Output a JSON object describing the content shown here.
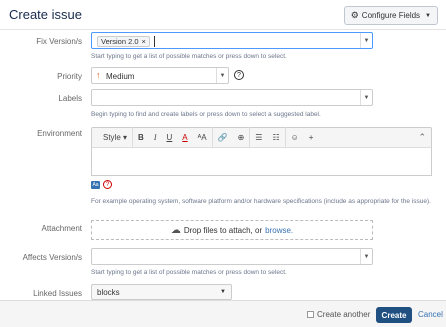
{
  "header": {
    "title": "Create issue",
    "configure_label": "Configure Fields"
  },
  "fix_versions": {
    "label": "Fix Version/s",
    "chip": "Version 2.0",
    "help": "Start typing to get a list of possible matches or press down to select."
  },
  "priority": {
    "label": "Priority",
    "value": "Medium"
  },
  "labels": {
    "label": "Labels",
    "help": "Begin typing to find and create labels or press down to select a suggested label."
  },
  "environment": {
    "label": "Environment",
    "toolbar": {
      "style": "Style",
      "bold": "B",
      "italic": "I",
      "underline": "U",
      "color": "A",
      "more_text": "ᴬA",
      "link": "🔗",
      "attach": "⊕",
      "bullets": "☰",
      "numbered": "☷",
      "emoji": "☺",
      "insert": "+"
    },
    "help": "For example operating system, software platform and/or hardware specifications (include as appropriate for the issue)."
  },
  "attachment": {
    "label": "Attachment",
    "text": "Drop files to attach, or",
    "link": "browse."
  },
  "affects_versions": {
    "label": "Affects Version/s",
    "help": "Start typing to get a list of possible matches or press down to select."
  },
  "linked_issues": {
    "label": "Linked Issues",
    "value": "blocks"
  },
  "footer": {
    "create_another": "Create another",
    "create": "Create",
    "cancel": "Cancel"
  }
}
